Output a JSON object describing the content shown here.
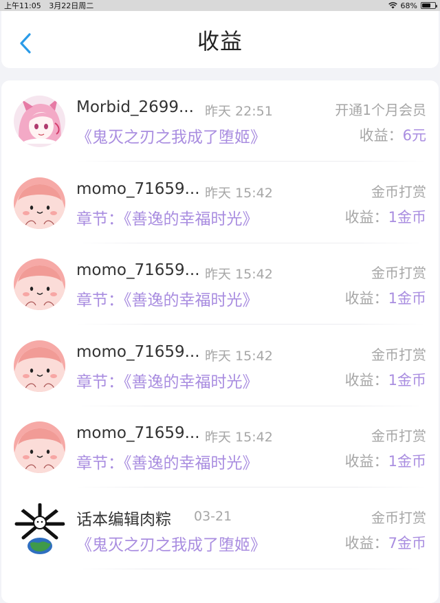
{
  "status_bar": {
    "time": "上午11:05",
    "date": "3月22日周二",
    "battery": "68%",
    "battery_level": 0.68
  },
  "header": {
    "title": "收益"
  },
  "records": [
    {
      "username": "Morbid_2699...",
      "time": "昨天 22:51",
      "type": "开通1个月会员",
      "work": "《鬼灭之刃之我成了堕姬》",
      "income_label": "收益：",
      "income_value": "6元",
      "avatar": "anime-girl"
    },
    {
      "username": "momo_71659...",
      "time": "昨天 15:42",
      "type": "金币打赏",
      "work": "章节：《善逸的幸福时光》",
      "income_label": "收益：",
      "income_value": "1金币",
      "avatar": "pink-blob"
    },
    {
      "username": "momo_71659...",
      "time": "昨天 15:42",
      "type": "金币打赏",
      "work": "章节：《善逸的幸福时光》",
      "income_label": "收益：",
      "income_value": "1金币",
      "avatar": "pink-blob"
    },
    {
      "username": "momo_71659...",
      "time": "昨天 15:42",
      "type": "金币打赏",
      "work": "章节：《善逸的幸福时光》",
      "income_label": "收益：",
      "income_value": "1金币",
      "avatar": "pink-blob"
    },
    {
      "username": "momo_71659...",
      "time": "昨天 15:42",
      "type": "金币打赏",
      "work": "章节：《善逸的幸福时光》",
      "income_label": "收益：",
      "income_value": "1金币",
      "avatar": "pink-blob"
    },
    {
      "username": "话本编辑肉粽",
      "time": "03-21",
      "type": "金币打赏",
      "work": "《鬼灭之刃之我成了堕姬》",
      "income_label": "收益：",
      "income_value": "7金币",
      "avatar": "earth-figure"
    }
  ],
  "colors": {
    "accent": "#a98de0",
    "back": "#2a9be8",
    "muted": "#a6a6a6"
  }
}
